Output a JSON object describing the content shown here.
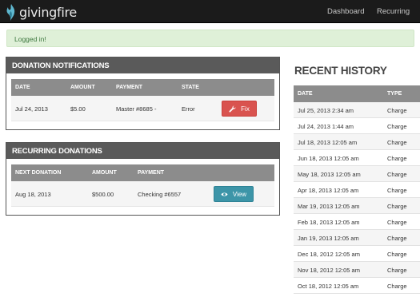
{
  "brand": {
    "name": "givingfire"
  },
  "nav": {
    "dashboard": "Dashboard",
    "recurring": "Recurring"
  },
  "alert": {
    "text": "Logged in!",
    "color": "#dff0d8"
  },
  "donation_notifications": {
    "title": "DONATION NOTIFICATIONS",
    "columns": [
      "DATE",
      "AMOUNT",
      "PAYMENT",
      "STATE"
    ],
    "rows": [
      {
        "date": "Jul 24, 2013",
        "amount": "$5.00",
        "payment": "Master #8685 -",
        "state": "Error",
        "action": "Fix"
      }
    ]
  },
  "recurring_donations": {
    "title": "RECURRING DONATIONS",
    "columns": [
      "NEXT DONATION",
      "AMOUNT",
      "PAYMENT"
    ],
    "rows": [
      {
        "next": "Aug 18, 2013",
        "amount": "$500.00",
        "payment": "Checking #6557",
        "action": "View"
      }
    ]
  },
  "recent_history": {
    "title": "RECENT HISTORY",
    "columns": [
      "DATE",
      "TYPE"
    ],
    "rows": [
      {
        "date": "Jul 25, 2013 2:34 am",
        "type": "Charge"
      },
      {
        "date": "Jul 24, 2013 1:44 am",
        "type": "Charge"
      },
      {
        "date": "Jul 18, 2013 12:05 am",
        "type": "Charge"
      },
      {
        "date": "Jun 18, 2013 12:05 am",
        "type": "Charge"
      },
      {
        "date": "May 18, 2013 12:05 am",
        "type": "Charge"
      },
      {
        "date": "Apr 18, 2013 12:05 am",
        "type": "Charge"
      },
      {
        "date": "Mar 19, 2013 12:05 am",
        "type": "Charge"
      },
      {
        "date": "Feb 18, 2013 12:05 am",
        "type": "Charge"
      },
      {
        "date": "Jan 19, 2013 12:05 am",
        "type": "Charge"
      },
      {
        "date": "Dec 18, 2012 12:05 am",
        "type": "Charge"
      },
      {
        "date": "Nov 18, 2012 12:05 am",
        "type": "Charge"
      },
      {
        "date": "Oct 18, 2012 12:05 am",
        "type": "Charge"
      }
    ]
  },
  "colors": {
    "fix_button": "#d9534f",
    "view_button": "#3d95a8",
    "panel_header": "#5a5a5a",
    "table_header": "#8c8c8c"
  },
  "icons": {
    "logo": "flame-icon",
    "fix": "wrench-icon",
    "view": "eye-icon"
  }
}
